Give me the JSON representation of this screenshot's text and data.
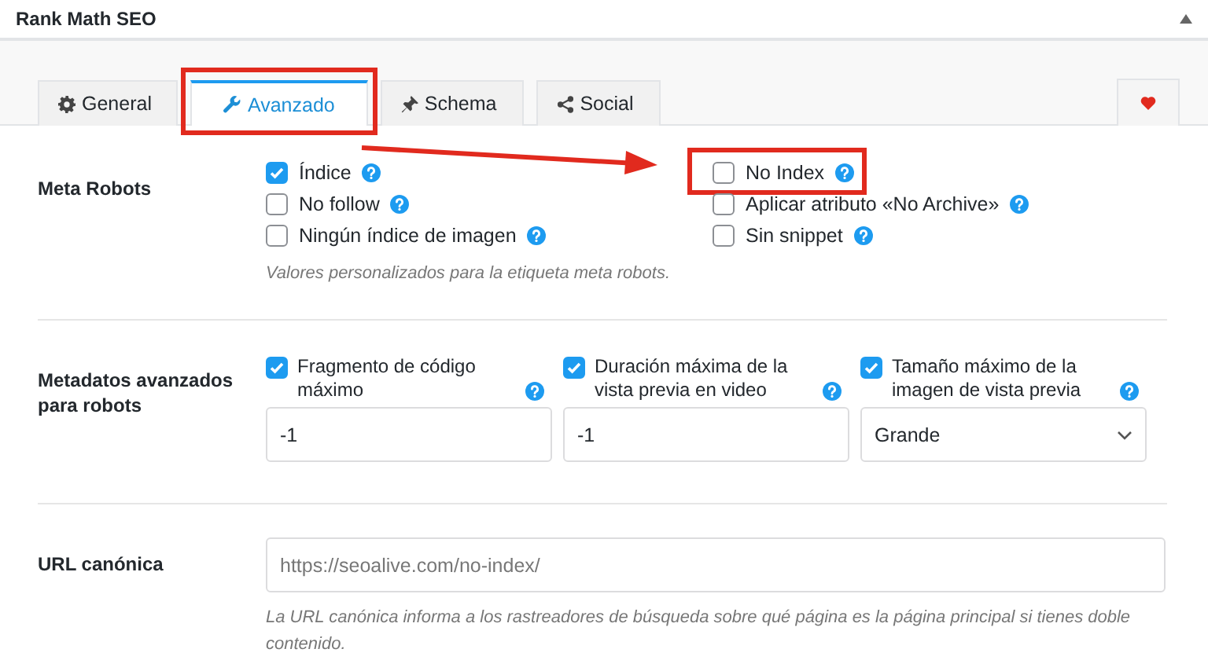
{
  "panel": {
    "title": "Rank Math SEO"
  },
  "tabs": [
    {
      "label": "General",
      "selected": false,
      "highlighted": false
    },
    {
      "label": "Avanzado",
      "selected": true,
      "highlighted": true
    },
    {
      "label": "Schema",
      "selected": false,
      "highlighted": false
    },
    {
      "label": "Social",
      "selected": false,
      "highlighted": false
    }
  ],
  "meta_robots": {
    "label": "Meta Robots",
    "columns": [
      [
        {
          "label": "Índice",
          "checked": true,
          "highlighted": false
        },
        {
          "label": "No follow",
          "checked": false,
          "highlighted": false
        },
        {
          "label": "Ningún índice de imagen",
          "checked": false,
          "highlighted": false
        }
      ],
      [
        {
          "label": "No Index",
          "checked": false,
          "highlighted": true
        },
        {
          "label": "Aplicar atributo «No Archive»",
          "checked": false,
          "highlighted": false
        },
        {
          "label": "Sin snippet",
          "checked": false,
          "highlighted": false
        }
      ]
    ],
    "hint": "Valores personalizados para la etiqueta meta robots."
  },
  "advanced_robots": {
    "label": "Metadatos avanzados para robots",
    "fields": [
      {
        "kind": "input",
        "label": "Fragmento de código máximo",
        "checked": true,
        "value": "-1"
      },
      {
        "kind": "input",
        "label": "Duración máxima de la vista previa en video",
        "checked": true,
        "value": "-1"
      },
      {
        "kind": "select",
        "label": "Tamaño máximo de la imagen de vista previa",
        "checked": true,
        "value": "Grande"
      }
    ]
  },
  "canonical": {
    "label": "URL canónica",
    "placeholder": "https://seoalive.com/no-index/",
    "hint": "La URL canónica informa a los rastreadores de búsqueda sobre qué página es la página principal si tienes doble contenido."
  }
}
